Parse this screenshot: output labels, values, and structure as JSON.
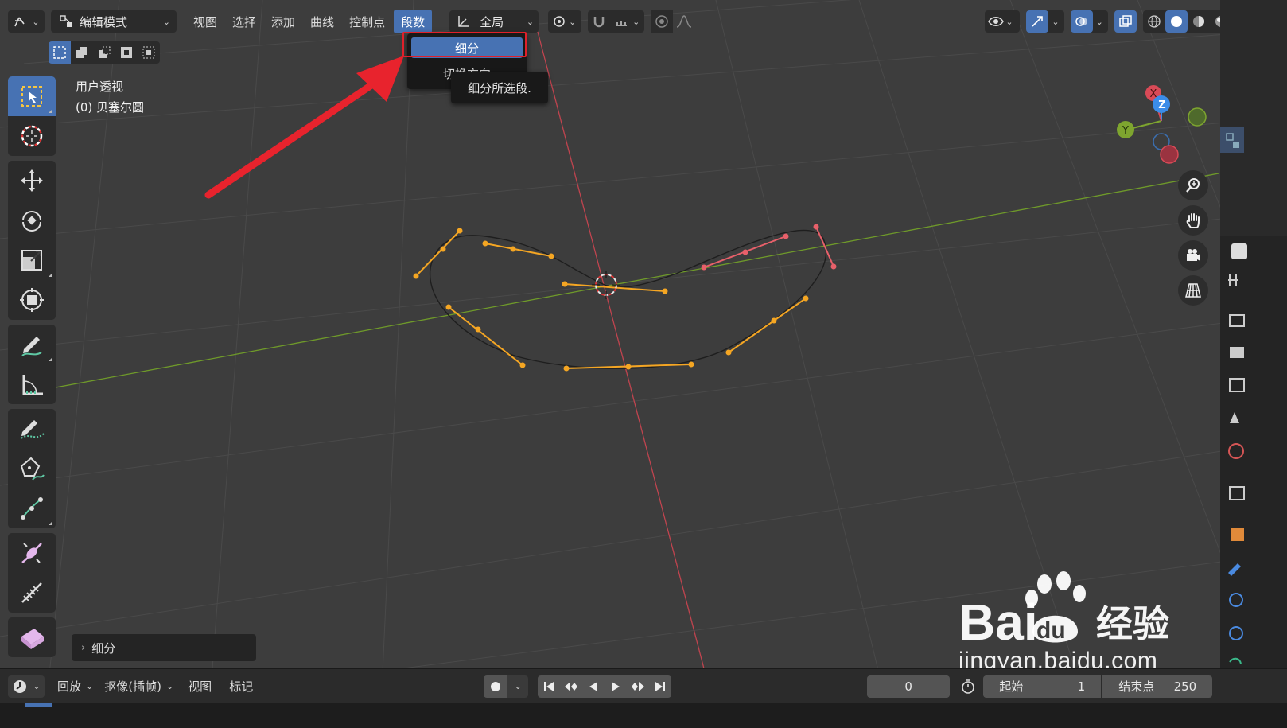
{
  "header": {
    "editor_icon": "curve-editor-icon",
    "mode_label": "编辑模式",
    "menus": [
      "视图",
      "选择",
      "添加",
      "曲线",
      "控制点",
      "段数"
    ],
    "active_menu": "段数",
    "transform_orientation": "全局"
  },
  "segments_menu": {
    "items": [
      "细分",
      "切换方向"
    ],
    "highlighted": "细分",
    "tooltip": "细分所选段."
  },
  "viewport": {
    "view_name": "用户透视",
    "object_name": "(0) 贝塞尔圆",
    "axis_labels": {
      "x": "X",
      "y": "Y",
      "z": "Z"
    }
  },
  "last_operator": {
    "label": "细分"
  },
  "timeline": {
    "playback_label": "回放",
    "keying_label": "抠像(插帧)",
    "view_label": "视图",
    "marker_label": "标记",
    "current_frame": "0",
    "start_label": "起始",
    "start_value": "1",
    "end_label": "结束点",
    "end_value": "250"
  },
  "watermark": {
    "brand": "Bai",
    "brand_suffix": "du",
    "cn": "经验",
    "url": "jingyan.baidu.com"
  },
  "colors": {
    "accent": "#4772b3",
    "handle": "#f5a623",
    "selected_handle": "#e8606a",
    "highlight_box": "#e0202a",
    "x_axis": "#d94a57",
    "y_axis": "#7ea52f",
    "z_axis": "#3b8ce8"
  }
}
